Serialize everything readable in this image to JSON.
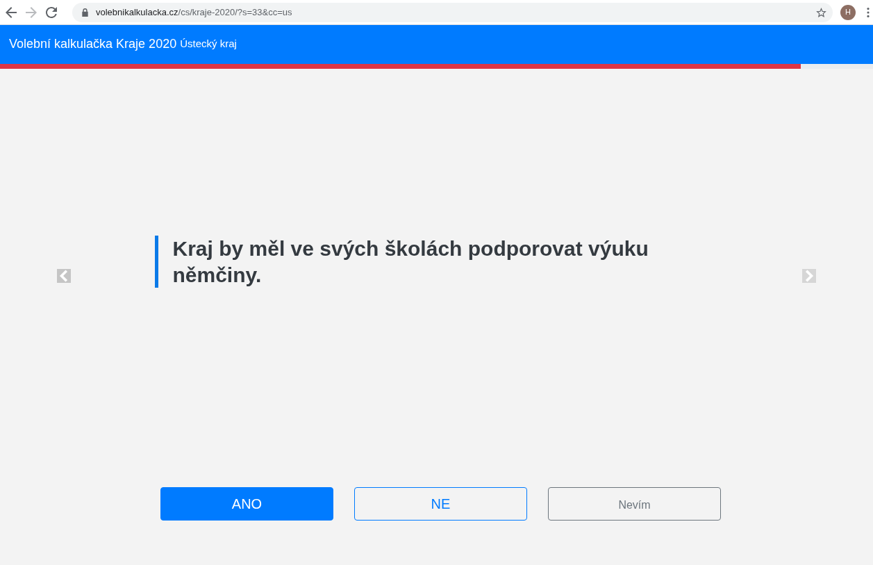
{
  "browser": {
    "nav_buttons": [
      {
        "kind": "back",
        "disabled": false
      },
      {
        "kind": "forward",
        "disabled": true
      },
      {
        "kind": "reload",
        "disabled": false
      }
    ],
    "url_host": "volebnikalkulacka.cz",
    "url_path": "/cs/kraje-2020/?s=33&cc=us",
    "profile_initial": "H"
  },
  "header": {
    "title": "Volební kalkulačka Kraje 2020",
    "region": "Ústecký kraj"
  },
  "progress": {
    "level": 0.917
  },
  "slide_arrows": [
    {
      "kind": "previous",
      "disabled": false
    },
    {
      "kind": "next",
      "disabled": true
    }
  ],
  "question": {
    "text": "Kraj by měl ve svých školách podporovat výuku němčiny."
  },
  "answers": [
    {
      "label": "ANO",
      "kind": "primary"
    },
    {
      "label": "NE",
      "kind": "outline"
    },
    {
      "label": "Nevím",
      "kind": "secondary"
    }
  ]
}
